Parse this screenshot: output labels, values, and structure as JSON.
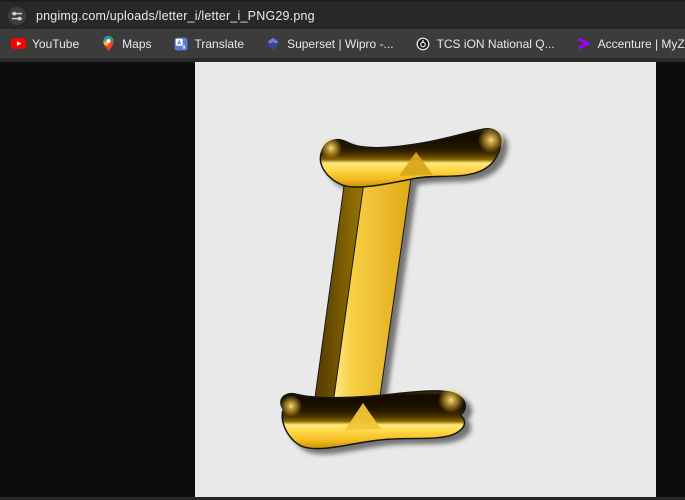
{
  "address_bar": {
    "url": "pngimg.com/uploads/letter_i/letter_i_PNG29.png"
  },
  "bookmarks": {
    "items": [
      {
        "label": "YouTube",
        "icon": "youtube-icon"
      },
      {
        "label": "Maps",
        "icon": "google-maps-icon"
      },
      {
        "label": "Translate",
        "icon": "google-translate-icon"
      },
      {
        "label": "Superset | Wipro -...",
        "icon": "superset-icon"
      },
      {
        "label": "TCS iON National Q...",
        "icon": "tcs-ion-icon"
      },
      {
        "label": "Accenture | MyZone",
        "icon": "accenture-icon"
      }
    ]
  },
  "content": {
    "letter": "I",
    "image_style": "golden-3d-letter",
    "colors": {
      "gold_bright": "#ffe97f",
      "gold": "#f7c843",
      "gold_deep": "#cf9a0e",
      "facet_dark": "#6e5200",
      "serif_dark_face": "#1f1400",
      "outline": "#191919",
      "panel_bg": "#e9e9e9",
      "page_bg": "#0d0d0d",
      "accent_accenture": "#a100ff",
      "accent_youtube": "#ff0000"
    }
  }
}
